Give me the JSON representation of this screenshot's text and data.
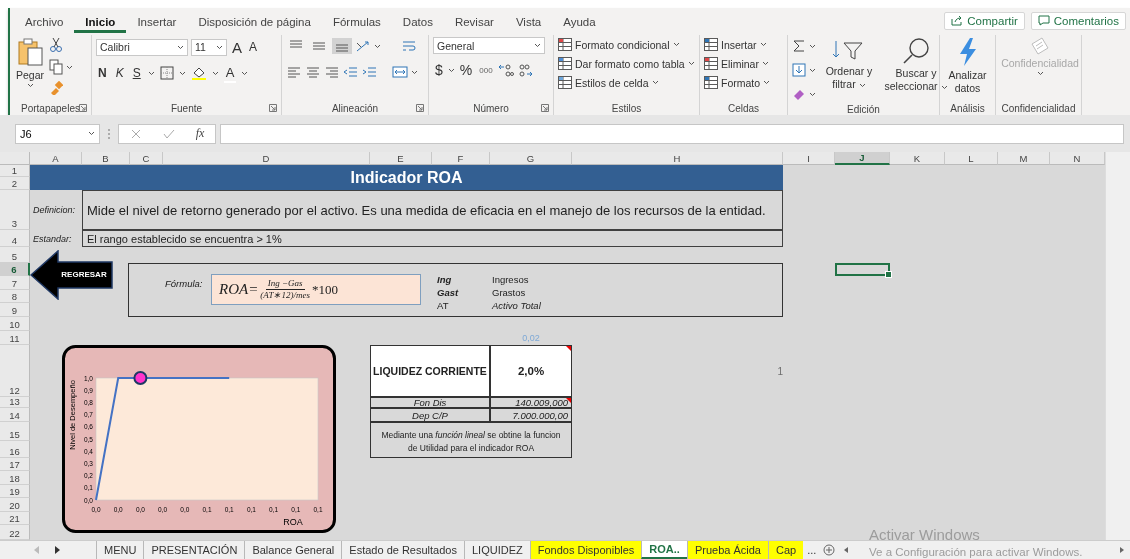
{
  "ribbon": {
    "tabs": [
      {
        "label": "Archivo",
        "selected": false
      },
      {
        "label": "Inicio",
        "selected": true
      },
      {
        "label": "Insertar",
        "selected": false
      },
      {
        "label": "Disposición de página",
        "selected": false
      },
      {
        "label": "Fórmulas",
        "selected": false
      },
      {
        "label": "Datos",
        "selected": false
      },
      {
        "label": "Revisar",
        "selected": false
      },
      {
        "label": "Vista",
        "selected": false
      },
      {
        "label": "Ayuda",
        "selected": false
      }
    ],
    "share_button": "Compartir",
    "comments_button": "Comentarios",
    "clipboard": {
      "label": "Portapapeles",
      "paste": "Pegar"
    },
    "font": {
      "label": "Fuente",
      "name": "Calibri",
      "size": "11",
      "grow": "A",
      "shrink": "A",
      "bold": "N",
      "italic": "K",
      "underline": "S",
      "font_color": "A"
    },
    "alignment": {
      "label": "Alineación",
      "vertical": [
        {
          "selected": false
        },
        {
          "selected": false
        },
        {
          "selected": true
        }
      ]
    },
    "number": {
      "label": "Número",
      "format": "General",
      "currency": "$",
      "percent": "%",
      "thousands": "000"
    },
    "styles": {
      "label": "Estilos",
      "items": [
        "Formato condicional",
        "Dar formato como tabla",
        "Estilos de celda"
      ]
    },
    "cells": {
      "label": "Celdas",
      "items": [
        "Insertar",
        "Eliminar",
        "Formato"
      ]
    },
    "editing": {
      "label": "Edición",
      "sort": "Ordenar y filtrar",
      "find": "Buscar y seleccionar"
    },
    "analysis": {
      "label": "Análisis",
      "button": "Analizar datos"
    },
    "sensitivity": {
      "label": "Confidencialidad",
      "button": "Confidencialidad",
      "disabled": true
    }
  },
  "formula_bar": {
    "name_box": "J6",
    "fx": "fx"
  },
  "columns": [
    {
      "label": "A",
      "selected": false
    },
    {
      "label": "B",
      "selected": false
    },
    {
      "label": "C",
      "selected": false
    },
    {
      "label": "D",
      "selected": false
    },
    {
      "label": "E",
      "selected": false
    },
    {
      "label": "F",
      "selected": false
    },
    {
      "label": "G",
      "selected": false
    },
    {
      "label": "H",
      "selected": false
    },
    {
      "label": "I",
      "selected": false
    },
    {
      "label": "J",
      "selected": true
    },
    {
      "label": "K",
      "selected": false
    },
    {
      "label": "L",
      "selected": false
    },
    {
      "label": "M",
      "selected": false
    },
    {
      "label": "N",
      "selected": false
    }
  ],
  "rows": [
    {
      "label": "1",
      "selected": false
    },
    {
      "label": "2",
      "selected": false
    },
    {
      "label": "3",
      "selected": false
    },
    {
      "label": "4",
      "selected": false
    },
    {
      "label": "5",
      "selected": false
    },
    {
      "label": "6",
      "selected": true
    },
    {
      "label": "7",
      "selected": false
    },
    {
      "label": "8",
      "selected": false
    },
    {
      "label": "9",
      "selected": false
    },
    {
      "label": "10",
      "selected": false
    },
    {
      "label": "11",
      "selected": false
    },
    {
      "label": "12",
      "selected": false
    },
    {
      "label": "13",
      "selected": false
    },
    {
      "label": "14",
      "selected": false
    },
    {
      "label": "15",
      "selected": false
    },
    {
      "label": "16",
      "selected": false
    },
    {
      "label": "17",
      "selected": false
    },
    {
      "label": "18",
      "selected": false
    },
    {
      "label": "19",
      "selected": false
    },
    {
      "label": "20",
      "selected": false
    },
    {
      "label": "21",
      "selected": false
    },
    {
      "label": "22",
      "selected": false
    }
  ],
  "sheet": {
    "title": "Indicador ROA",
    "definition_label": "Definicion:",
    "definition": "Mide el nivel de retorno generado por el activo. Es una medida de eficacia en el manejo de los recursos de la entidad.",
    "standard_label": "Estandar:",
    "standard": "El rango establecido se encuentra > 1%",
    "back_button": "REGRESAR",
    "formula": {
      "label": "Fórmula:",
      "lhs": "ROA=",
      "numerator": "Ing −Gas",
      "denominator": "(AT∗12)/mes",
      "factor": "*100",
      "legend": [
        {
          "kind": "variable",
          "symbol": "Ing",
          "meaning": "Ingresos"
        },
        {
          "kind": "variable",
          "symbol": "Gast",
          "meaning": "Grastos"
        },
        {
          "kind": "total",
          "symbol": "AT",
          "meaning": "Activo Total"
        }
      ]
    },
    "faint_values": [
      "0,02",
      "1"
    ],
    "table": {
      "header": "LIQUIDEZ CORRIENTE",
      "value": "2,0%",
      "rows": [
        {
          "label": "Fon Dis",
          "value": "140.009,000"
        },
        {
          "label": "Dep C/P",
          "value": "7.000.000,00"
        }
      ],
      "note": "Mediante una *función lineal*  se obtine la funcion de Utilidad para el indicador ROA"
    },
    "chart_data": {
      "type": "line",
      "xlabel": "ROA",
      "ylabel": "Nivel de Desempeño",
      "categories": [
        "0,0",
        "0,0",
        "0,0",
        "0,0",
        "0,0",
        "0,1",
        "0,1",
        "0,1",
        "0,1",
        "0,1",
        "0,1"
      ],
      "ylim": [
        0,
        1
      ],
      "yticks": [
        {
          "value": 0,
          "label": "0,0"
        },
        {
          "value": 0.1,
          "label": "0,1"
        },
        {
          "value": 0.2,
          "label": "0,2"
        },
        {
          "value": 0.3,
          "label": "0,3"
        },
        {
          "value": 0.4,
          "label": "0,4"
        },
        {
          "value": 0.5,
          "label": "0,5"
        },
        {
          "value": 0.6,
          "label": "0,6"
        },
        {
          "value": 0.7,
          "label": "0,7"
        },
        {
          "value": 0.8,
          "label": "0,8"
        },
        {
          "value": 0.9,
          "label": "0,9"
        },
        {
          "value": 1,
          "label": "1,0"
        }
      ],
      "series": [
        {
          "color": "#4472c4",
          "marker": false,
          "values": [
            0,
            1,
            1,
            1,
            1,
            1,
            1,
            null,
            null,
            null,
            null
          ]
        },
        {
          "color": "#ff33cc",
          "marker": true,
          "values": [
            null,
            null,
            1,
            null,
            null,
            null,
            null,
            null,
            null,
            null,
            null
          ]
        }
      ]
    }
  },
  "sheet_tabs": [
    {
      "label": "MENU",
      "selected": false
    },
    {
      "label": "PRESENTACIÓN",
      "selected": false
    },
    {
      "label": "Balance General",
      "selected": false
    },
    {
      "label": "Estado de Resultados",
      "selected": false
    },
    {
      "label": "LIQUIDEZ",
      "selected": false
    },
    {
      "label": "Fondos Disponibles",
      "selected": false,
      "color": "#ffff00"
    },
    {
      "label": "ROA..",
      "selected": true
    },
    {
      "label": "Prueba Ácida",
      "selected": false,
      "color": "#ffff00"
    },
    {
      "label": "Cap",
      "selected": false,
      "color": "#ffff00"
    }
  ],
  "more_tabs": "...",
  "windows_notice": {
    "title": "Activar Windows",
    "subtitle": "Ve a Configuración para activar Windows."
  }
}
